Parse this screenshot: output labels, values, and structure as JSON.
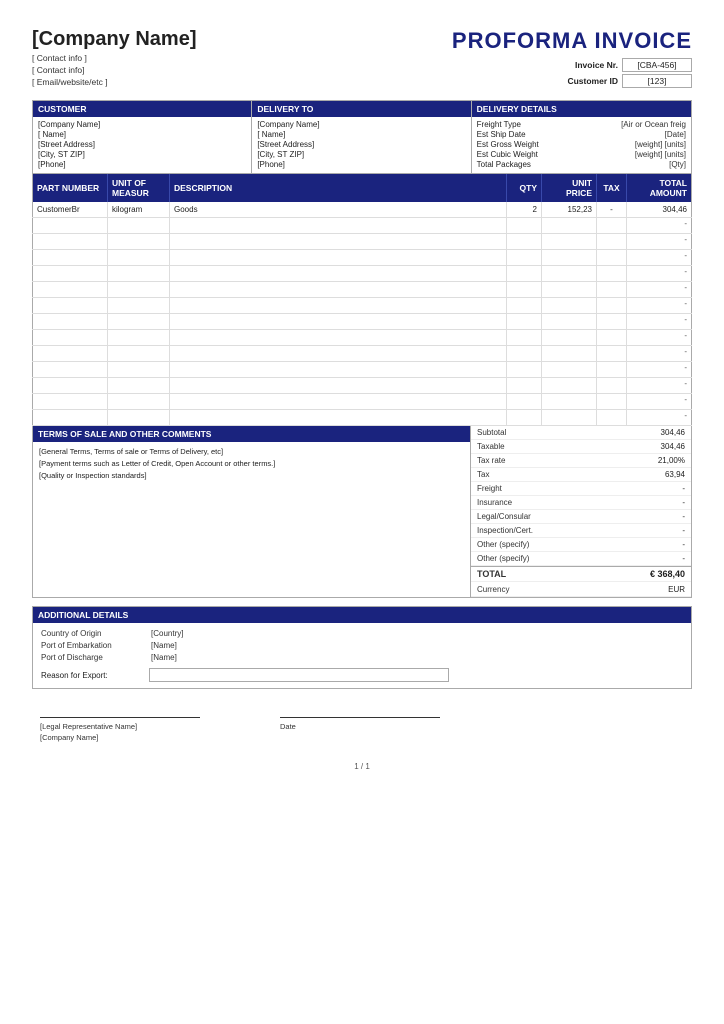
{
  "company": {
    "name": "[Company Name]",
    "contact1": "[ Contact info ]",
    "contact2": "[ Contact info]",
    "contact3": "[ Email/website/etc ]"
  },
  "invoice_title": "PROFORMA INVOICE",
  "invoice_meta": {
    "invoice_nr_label": "Invoice Nr.",
    "invoice_nr_value": "[CBA-456]",
    "customer_id_label": "Customer ID",
    "customer_id_value": "[123]"
  },
  "customer": {
    "header": "CUSTOMER",
    "company": "[Company Name]",
    "name": "[ Name]",
    "address": "[Street Address]",
    "city": "[City, ST  ZIP]",
    "phone": "[Phone]"
  },
  "delivery_to": {
    "header": "DELIVERY TO",
    "company": "[Company Name]",
    "name": "[ Name]",
    "address": "[Street Address]",
    "city": "[City, ST  ZIP]",
    "phone": "[Phone]"
  },
  "delivery_details": {
    "header": "DELIVERY DETAILS",
    "freight_type_label": "Freight Type",
    "freight_type_value": "[Air or Ocean freig",
    "ship_date_label": "Est Ship Date",
    "ship_date_value": "[Date]",
    "gross_weight_label": "Est Gross Weight",
    "gross_weight_value": "[weight] [units]",
    "cubic_weight_label": "Est Cubic Weight",
    "cubic_weight_value": "[weight] [units]",
    "packages_label": "Total Packages",
    "packages_value": "[Qty]"
  },
  "table": {
    "headers": {
      "part": "PART NUMBER",
      "unit": "UNIT OF MEASUR",
      "description": "DESCRIPTION",
      "qty": "QTY",
      "unit_price": "UNIT PRICE",
      "tax": "TAX",
      "total": "TOTAL AMOUNT"
    },
    "rows": [
      {
        "part": "CustomerBr",
        "unit": "kilogram",
        "description": "Goods",
        "qty": "2",
        "unit_price": "152,23",
        "tax": "-",
        "total": "304,46"
      }
    ],
    "empty_rows": 13
  },
  "totals": {
    "subtotal_label": "Subtotal",
    "subtotal_value": "304,46",
    "taxable_label": "Taxable",
    "taxable_value": "304,46",
    "tax_rate_label": "Tax rate",
    "tax_rate_value": "21,00%",
    "tax_label": "Tax",
    "tax_value": "63,94",
    "freight_label": "Freight",
    "freight_value": "-",
    "insurance_label": "Insurance",
    "insurance_value": "-",
    "legal_label": "Legal/Consular",
    "legal_value": "-",
    "inspection_label": "Inspection/Cert.",
    "inspection_value": "-",
    "other1_label": "Other (specify)",
    "other1_value": "-",
    "other2_label": "Other (specify)",
    "other2_value": "-",
    "total_label": "TOTAL",
    "total_symbol": "€",
    "total_value": "368,40",
    "currency_label": "Currency",
    "currency_value": "EUR"
  },
  "terms": {
    "header": "TERMS OF SALE AND OTHER COMMENTS",
    "line1": "[General Terms, Terms of sale or Terms of Delivery, etc]",
    "line2": "[Payment terms such as Letter of Credit, Open Account or other terms.]",
    "line3": "[Quality or Inspection standards]"
  },
  "additional": {
    "header": "ADDITIONAL DETAILS",
    "country_label": "Country of Origin",
    "country_value": "[Country]",
    "embarkation_label": "Port of Embarkation",
    "embarkation_value": "[Name]",
    "discharge_label": "Port of Discharge",
    "discharge_value": "[Name]",
    "reason_label": "Reason for Export:"
  },
  "signature": {
    "rep_label": "[Legal Representative Name]",
    "rep_sublabel": "[Company Name]",
    "date_label": "Date"
  },
  "page": "1 / 1"
}
